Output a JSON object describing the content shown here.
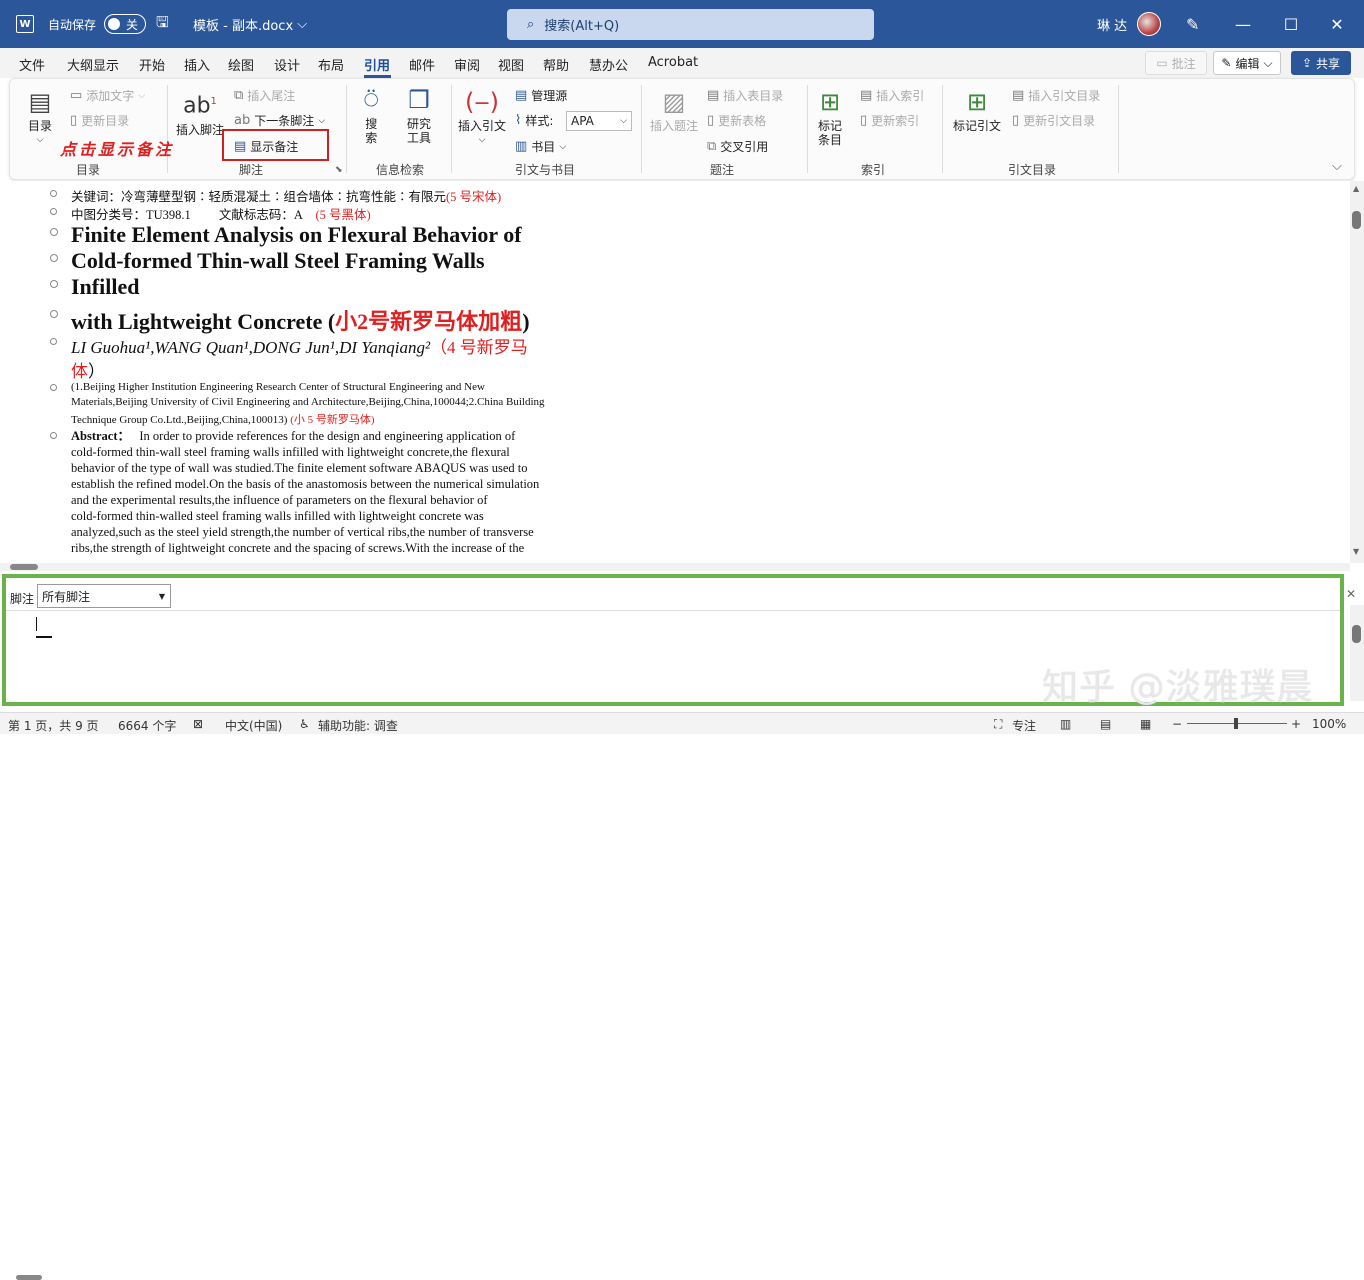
{
  "titlebar": {
    "logo": "W",
    "autosave_label": "自动保存",
    "autosave_state": "关",
    "doc_name": "模板 - 副本.docx",
    "doc_name_chevron": "⌄",
    "search_placeholder": "搜索(Alt+Q)",
    "user_name": "琳 达",
    "min": "—",
    "max": "☐",
    "close": "✕"
  },
  "menu": {
    "tabs": [
      "文件",
      "大纲显示",
      "开始",
      "插入",
      "绘图",
      "设计",
      "布局",
      "引用",
      "邮件",
      "审阅",
      "视图",
      "帮助",
      "慧办公",
      "Acrobat"
    ],
    "active": "引用",
    "comments_label": "批注",
    "editing_label": "编辑",
    "share_label": "共享"
  },
  "ribbon": {
    "toc": {
      "label": "目录",
      "add_text": "添加文字",
      "update_toc": "更新目录",
      "group": "目录"
    },
    "footnotes": {
      "insert_footnote": "插入脚注",
      "insert_endnote": "插入尾注",
      "next_footnote": "下一条脚注",
      "show_notes": "显示备注",
      "group": "脚注"
    },
    "research": {
      "search": "搜\n索",
      "search_a": "搜",
      "search_b": "索",
      "researcher_a": "研究",
      "researcher_b": "工具",
      "group": "信息检索"
    },
    "citations": {
      "insert_citation": "插入引文",
      "manage_sources": "管理源",
      "style_label": "样式:",
      "style_value": "APA",
      "bibliography": "书目",
      "group": "引文与书目"
    },
    "captions": {
      "insert_caption": "插入题注",
      "insert_table_of_figures": "插入表目录",
      "update_table": "更新表格",
      "cross_reference": "交叉引用",
      "group": "题注"
    },
    "index": {
      "mark_entry_a": "标记",
      "mark_entry_b": "条目",
      "insert_index": "插入索引",
      "update_index": "更新索引",
      "group": "索引"
    },
    "toa": {
      "mark_citation": "标记引文",
      "insert_toa": "插入引文目录",
      "update_toa": "更新引文目录",
      "group": "引文目录"
    },
    "annotation": "点击显示备注"
  },
  "document": {
    "keywords": "关键词：冷弯薄壁型钢∶轻质混凝土∶组合墙体∶抗弯性能∶有限元",
    "keywords_note": "(5 号宋体)",
    "clc": "中图分类号：TU398.1　　  文献标志码：A",
    "clc_note": "(5 号黑体)",
    "title_1": "Finite Element Analysis on Flexural Behavior of",
    "title_2": "Cold-formed Thin-wall Steel Framing Walls",
    "title_3": "Infilled",
    "title_4": "with Lightweight Concrete (",
    "title_4_note": "小2号新罗马体加粗",
    "title_4_end": ")",
    "authors": "LI Guohua¹,WANG Quan¹,DONG Jun¹,DI Yanqiang²",
    "authors_note_a": "（4 号新罗马",
    "authors_note_b": "体",
    "authors_note_c": "）",
    "affil_1": "(1.Beijing Higher Institution Engineering Research Center of Structural Engineering and New",
    "affil_2": "Materials,Beijing University of Civil Engineering and Architecture,Beijing,China,100044;2.China Building",
    "affil_3": "Technique Group Co.Ltd.,Beijing,China,100013)",
    "affil_note": "(小 5 号新罗马体)",
    "abstract_label": "Abstract：",
    "abstract_lines": [
      "In order to provide references for the design and engineering application of",
      "cold-formed thin-wall steel framing walls infilled with lightweight concrete,the flexural",
      "behavior of the type of wall was studied.The finite element software ABAQUS was used to",
      "establish the refined model.On the basis of the anastomosis between the numerical simulation",
      "and the experimental results,the influence of parameters on the flexural behavior of",
      "cold-formed thin-walled steel framing walls infilled with lightweight concrete was",
      "analyzed,such as the steel yield strength,the number of vertical ribs,the number of transverse",
      "ribs,the strength of lightweight concrete and the spacing of screws.With the increase of the"
    ]
  },
  "footnote_pane": {
    "label": "脚注",
    "filter_value": "所有脚注",
    "watermark": "知乎 @淡雅璞晨"
  },
  "status": {
    "page": "第 1 页，共 9 页",
    "words": "6664 个字",
    "language": "中文(中国)",
    "accessibility": "辅助功能: 调查",
    "focus": "专注",
    "zoom_minus": "−",
    "zoom_plus": "+",
    "zoom": "100%"
  }
}
